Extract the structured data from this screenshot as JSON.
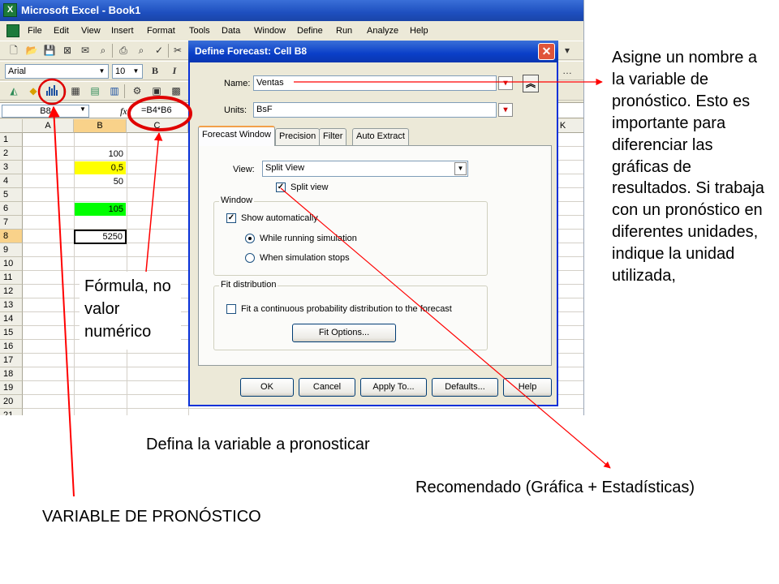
{
  "excel": {
    "title": "Microsoft Excel - Book1",
    "menus": [
      "File",
      "Edit",
      "View",
      "Insert",
      "Format",
      "Tools",
      "Data",
      "Window",
      "Define",
      "Run",
      "Analyze",
      "Help"
    ],
    "font_name": "Arial",
    "font_size": "10",
    "bold": "B",
    "italic": "I",
    "name_box": "B8",
    "fx_label": "fx",
    "formula": "=B4*B6",
    "columns": [
      "A",
      "B",
      "C",
      "K"
    ],
    "rows": [
      "1",
      "2",
      "3",
      "4",
      "5",
      "6",
      "7",
      "8",
      "9",
      "10",
      "11",
      "12",
      "13",
      "14",
      "15",
      "16",
      "17",
      "18",
      "19",
      "20",
      "21"
    ],
    "cells": {
      "b2": "100",
      "b3": "0,5",
      "b4": "50",
      "b6": "105",
      "b8": "5250"
    },
    "colors": {
      "yellow_cell": "#ffff00",
      "green_cell": "#00ff00",
      "title_bar": "#1e4fbf"
    }
  },
  "dialog": {
    "title": "Define Forecast: Cell B8",
    "close_glyph": "✕",
    "name_label": "Name:",
    "name_value": "Ventas",
    "units_label": "Units:",
    "units_value": "BsF",
    "expander_glyph": "︽",
    "tabs": [
      "Forecast Window",
      "Precision",
      "Filter",
      "Auto Extract"
    ],
    "view_label": "View:",
    "view_value": "Split View",
    "split_view_label": "Split view",
    "window_group": "Window",
    "show_auto_label": "Show automatically",
    "while_running_label": "While running simulation",
    "when_stops_label": "When simulation stops",
    "fit_group": "Fit distribution",
    "fit_continuous_label": "Fit a continuous probability distribution to the forecast",
    "fit_options_button": "Fit Options...",
    "buttons": {
      "ok": "OK",
      "cancel": "Cancel",
      "apply": "Apply To...",
      "defaults": "Defaults...",
      "help": "Help"
    },
    "check_glyph": "✓"
  },
  "annotations": {
    "side_note": "Asigne un nombre a la variable de pronóstico. Esto es importante para diferenciar las gráficas de resultados. Si trabaja con un pronóstico en diferentes unidades, indique la unidad utilizada,",
    "formula_note": "Fórmula, no valor numérico",
    "define_note": "Defina la variable a pronosticar",
    "recommended_note": "Recomendado (Gráfica + Estadísticas)",
    "variable_note": "VARIABLE DE PRONÓSTICO",
    "colors": {
      "arrow": "#ff0000",
      "circle": "#e00000"
    }
  }
}
